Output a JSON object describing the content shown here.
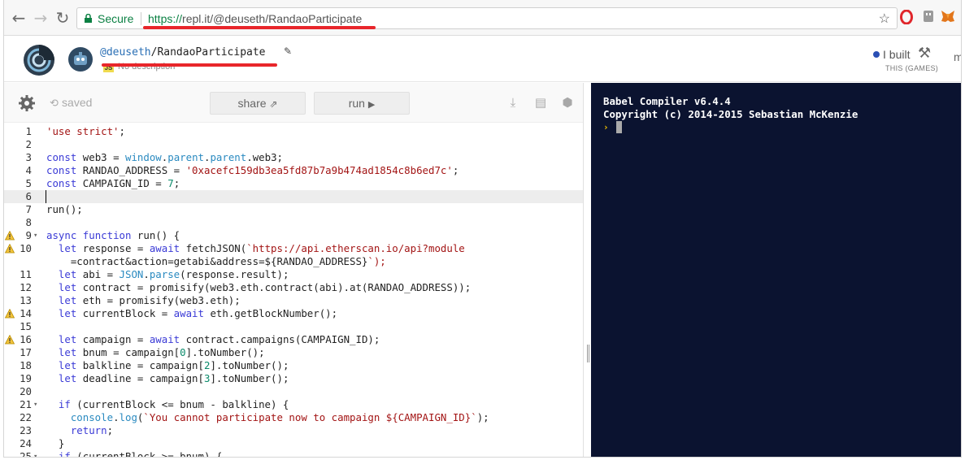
{
  "browser": {
    "secure_label": "Secure",
    "url_scheme": "https://",
    "url_rest": "repl.it/@deuseth/RandaoParticipate",
    "icons": [
      "back-icon",
      "forward-icon",
      "reload-icon",
      "lock-icon",
      "star-icon",
      "opera-icon",
      "extension-icon",
      "metamask-icon"
    ]
  },
  "header": {
    "user": "@deuseth",
    "repl_name": "/RandaoParticipate",
    "description": "No description",
    "language_badge": "JS",
    "ibuilt_label": "I built",
    "ibuilt_sub": "THIS (GAMES)",
    "more": "m"
  },
  "toolbar": {
    "saved_label": "saved",
    "share_label": "share",
    "run_label": "run"
  },
  "editor": {
    "active_line": 6,
    "lines": [
      {
        "n": "1",
        "code": "'use strict';",
        "warn": false,
        "fold": false
      },
      {
        "n": "2",
        "code": "",
        "warn": false,
        "fold": false
      },
      {
        "n": "3",
        "code": "const web3 = window.parent.parent.web3;",
        "warn": false,
        "fold": false
      },
      {
        "n": "4",
        "code": "const RANDAO_ADDRESS = '0xacefc159db3ea5fd87b7a9b474ad1854c8b6ed7c';",
        "warn": false,
        "fold": false
      },
      {
        "n": "5",
        "code": "const CAMPAIGN_ID = 7;",
        "warn": false,
        "fold": false
      },
      {
        "n": "6",
        "code": "",
        "warn": false,
        "fold": false
      },
      {
        "n": "7",
        "code": "run();",
        "warn": false,
        "fold": false
      },
      {
        "n": "8",
        "code": "",
        "warn": false,
        "fold": false
      },
      {
        "n": "9",
        "code": "async function run() {",
        "warn": true,
        "fold": true
      },
      {
        "n": "10",
        "code": "  let response = await fetchJSON(`https://api.etherscan.io/api?module",
        "warn": true,
        "fold": false
      },
      {
        "n": "",
        "code": "    =contract&action=getabi&address=${RANDAO_ADDRESS}`);",
        "warn": false,
        "fold": false
      },
      {
        "n": "11",
        "code": "  let abi = JSON.parse(response.result);",
        "warn": false,
        "fold": false
      },
      {
        "n": "12",
        "code": "  let contract = promisify(web3.eth.contract(abi).at(RANDAO_ADDRESS));",
        "warn": false,
        "fold": false
      },
      {
        "n": "13",
        "code": "  let eth = promisify(web3.eth);",
        "warn": false,
        "fold": false
      },
      {
        "n": "14",
        "code": "  let currentBlock = await eth.getBlockNumber();",
        "warn": true,
        "fold": false
      },
      {
        "n": "15",
        "code": "",
        "warn": false,
        "fold": false
      },
      {
        "n": "16",
        "code": "  let campaign = await contract.campaigns(CAMPAIGN_ID);",
        "warn": true,
        "fold": false
      },
      {
        "n": "17",
        "code": "  let bnum = campaign[0].toNumber();",
        "warn": false,
        "fold": false
      },
      {
        "n": "18",
        "code": "  let balkline = campaign[2].toNumber();",
        "warn": false,
        "fold": false
      },
      {
        "n": "19",
        "code": "  let deadline = campaign[3].toNumber();",
        "warn": false,
        "fold": false
      },
      {
        "n": "20",
        "code": "",
        "warn": false,
        "fold": false
      },
      {
        "n": "21",
        "code": "  if (currentBlock <= bnum - balkline) {",
        "warn": false,
        "fold": true
      },
      {
        "n": "22",
        "code": "    console.log(`You cannot participate now to campaign ${CAMPAIGN_ID}`);",
        "warn": false,
        "fold": false
      },
      {
        "n": "23",
        "code": "    return;",
        "warn": false,
        "fold": false
      },
      {
        "n": "24",
        "code": "  }",
        "warn": false,
        "fold": false
      },
      {
        "n": "25",
        "code": "  if (currentBlock >= bnum) {",
        "warn": false,
        "fold": true
      }
    ]
  },
  "console": {
    "line1": "Babel Compiler v6.4.4",
    "line2": "Copyright (c) 2014-2015 Sebastian McKenzie",
    "prompt": "›"
  },
  "colors": {
    "secure_green": "#0b8043",
    "console_bg": "#0b1330",
    "annotation_red": "#e8262b",
    "keyword_blue": "#3a3ad6",
    "string_red": "#a31515"
  }
}
